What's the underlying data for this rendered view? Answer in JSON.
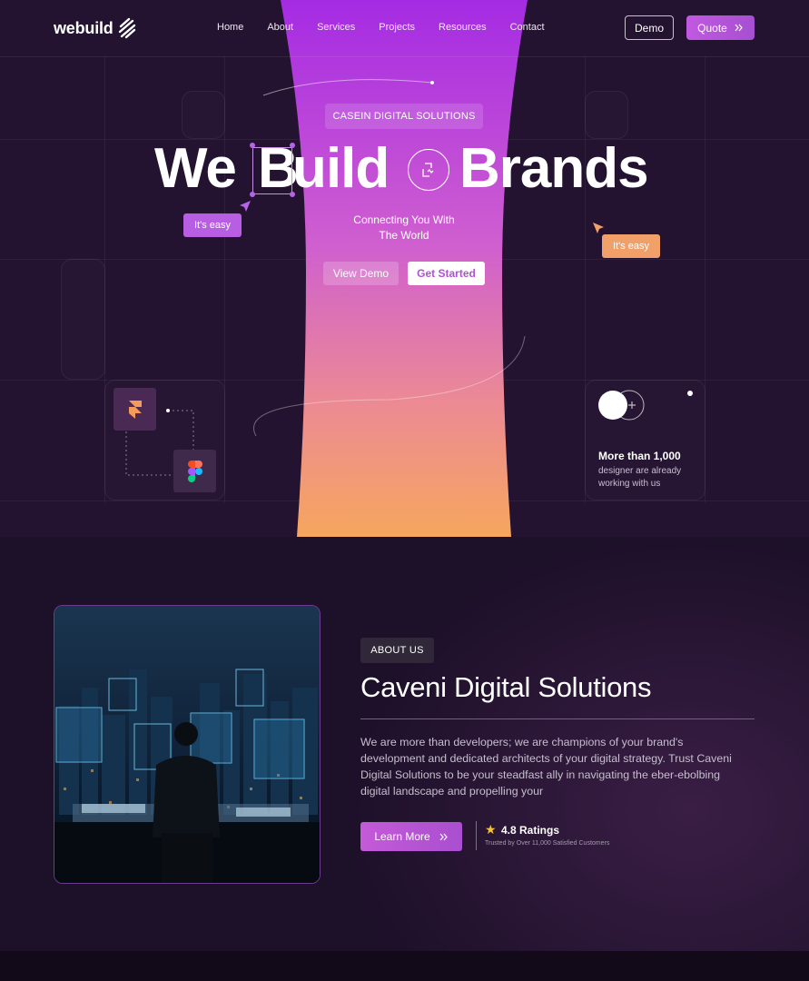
{
  "brand": {
    "logo_text": "webuild"
  },
  "nav": {
    "items": [
      "Home",
      "About",
      "Services",
      "Projects",
      "Resources",
      "Contact"
    ]
  },
  "header_buttons": {
    "demo": "Demo",
    "quote": "Quote"
  },
  "hero": {
    "badge": "CASEIN DIGITAL SOLUTIONS",
    "headline_we": "We",
    "headline_b": "B",
    "headline_uild": "uild",
    "headline_brands": "Brands",
    "tag_left": "It's easy",
    "tag_right": "It's easy",
    "subtitle_line1": "Connecting You With",
    "subtitle_line2": "The World",
    "btn_view_demo": "View Demo",
    "btn_get_started": "Get Started"
  },
  "stats": {
    "title": "More than 1,000",
    "line1": "designer are already",
    "line2": "working with us"
  },
  "about": {
    "badge": "ABOUT US",
    "title": "Caveni Digital Solutions",
    "desc_lines": [
      "We are more than developers; we are champions of your brand's",
      "development and dedicated architects of your digital strategy. Trust Caveni",
      "Digital Solutions to be your steadfast ally in navigating the eber-ebolbing",
      "digital landscape and propelling your"
    ],
    "btn_learn_more": "Learn More",
    "rating_value": "4.8 Ratings",
    "rating_sub": "Trusted by Over 11,000 Satisfied Customers"
  },
  "icons": {
    "logo": "logo-stripes-icon",
    "quote_arrow": "double-chevron-right-icon",
    "framer": "framer-icon",
    "figma": "figma-icon",
    "center": "design-tool-icon",
    "star": "star-icon"
  },
  "colors": {
    "background": "#1d1029",
    "accent_purple": "#b85ee3",
    "accent_orange": "#f2a06a",
    "beam_top": "#a52be3",
    "beam_bottom": "#f6a65e"
  }
}
